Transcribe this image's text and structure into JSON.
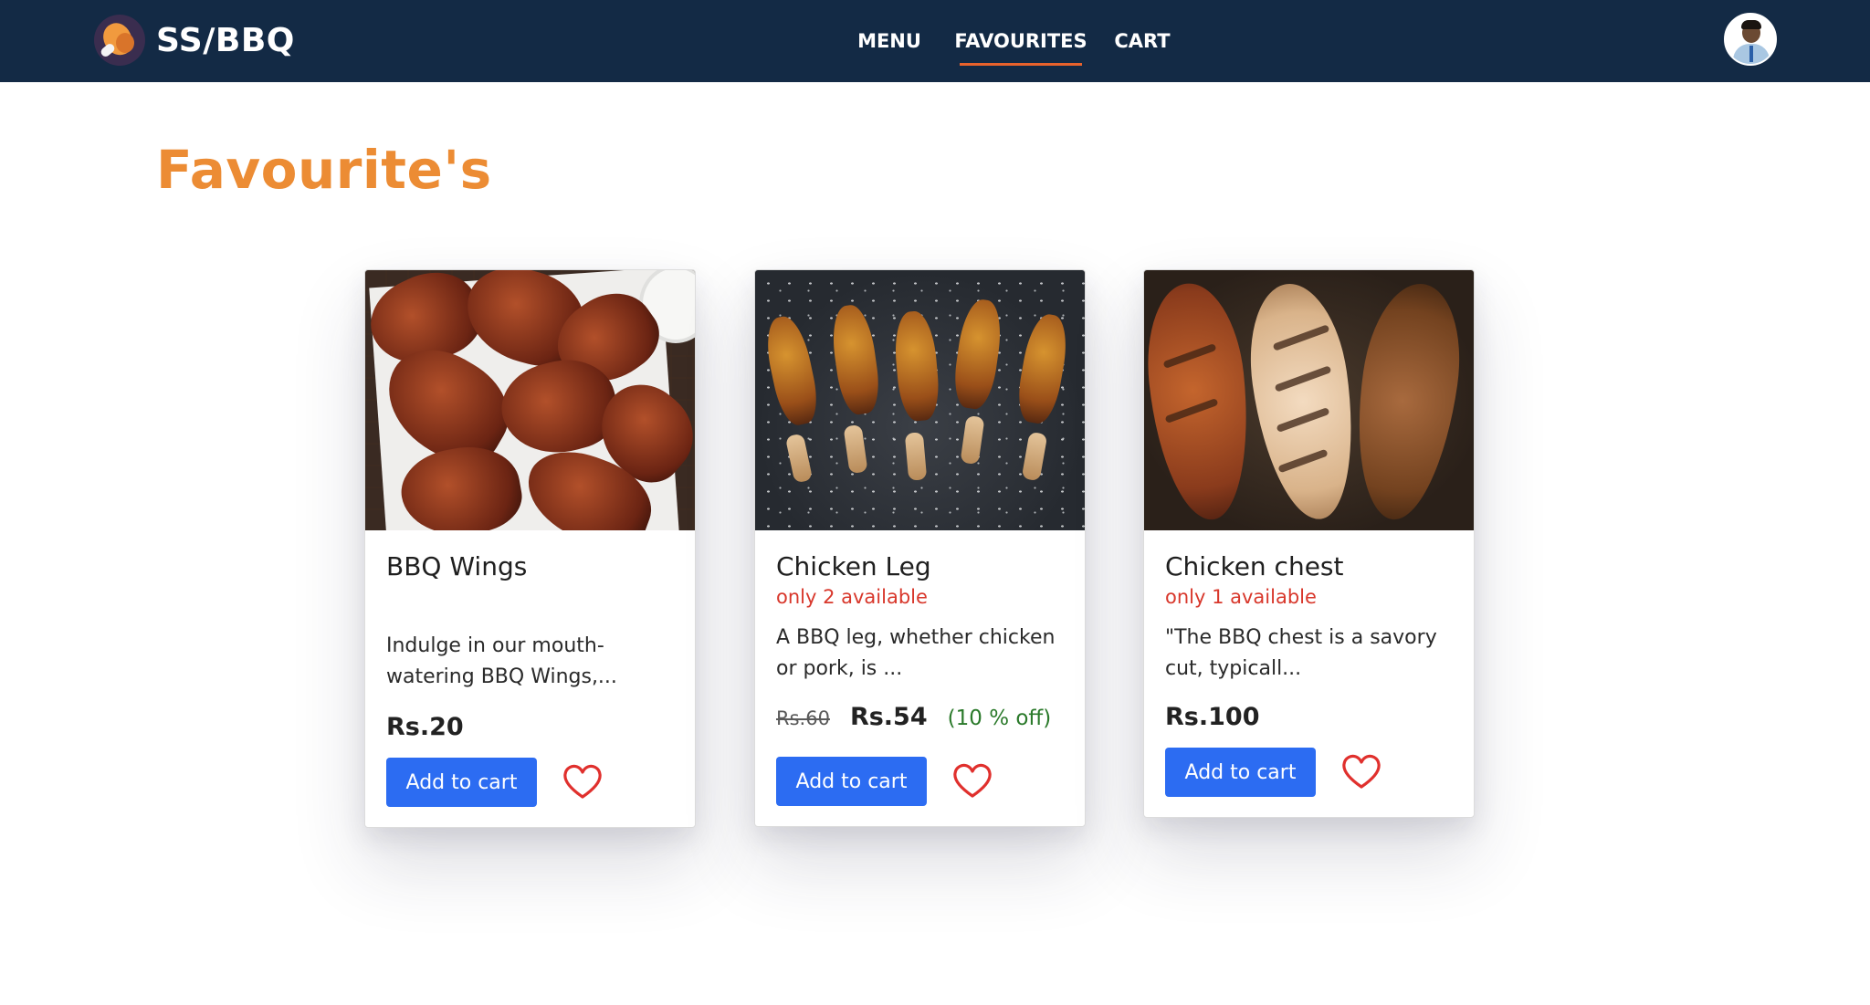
{
  "brand": {
    "name": "SS/BBQ"
  },
  "nav": {
    "links": [
      {
        "label": "MENU",
        "active": false
      },
      {
        "label": "FAVOURITES",
        "active": true
      },
      {
        "label": "CART",
        "active": false
      }
    ]
  },
  "page": {
    "title": "Favourite's"
  },
  "cards": [
    {
      "title": "BBQ Wings",
      "availability": "",
      "description": "Indulge in our mouth-watering BBQ Wings,...",
      "price": "Rs.20",
      "original_price": "",
      "discount": "",
      "button": "Add to cart",
      "favourited": true,
      "image": "bbq-wings-photo"
    },
    {
      "title": "Chicken Leg",
      "availability": "only 2 available",
      "description": "A BBQ leg, whether chicken or pork, is ...",
      "price": "Rs.54",
      "original_price": "Rs.60",
      "discount": "(10 % off)",
      "button": "Add to cart",
      "favourited": true,
      "image": "chicken-leg-photo"
    },
    {
      "title": "Chicken chest",
      "availability": "only 1 available",
      "description": "\"The BBQ chest is a savory cut, typicall...",
      "price": "Rs.100",
      "original_price": "",
      "discount": "",
      "button": "Add to cart",
      "favourited": true,
      "image": "chicken-chest-photo"
    }
  ],
  "colors": {
    "navbar": "#132a45",
    "accent_title": "#ec8c34",
    "active_underline": "#e8622c",
    "button": "#2c6cf2",
    "heart": "#e0302d",
    "availability": "#d8372b",
    "discount": "#2b7a2b"
  },
  "icons": {
    "favourite": "heart-outline-icon",
    "avatar": "user-avatar-photo",
    "logo": "chicken-drumstick-logo"
  }
}
